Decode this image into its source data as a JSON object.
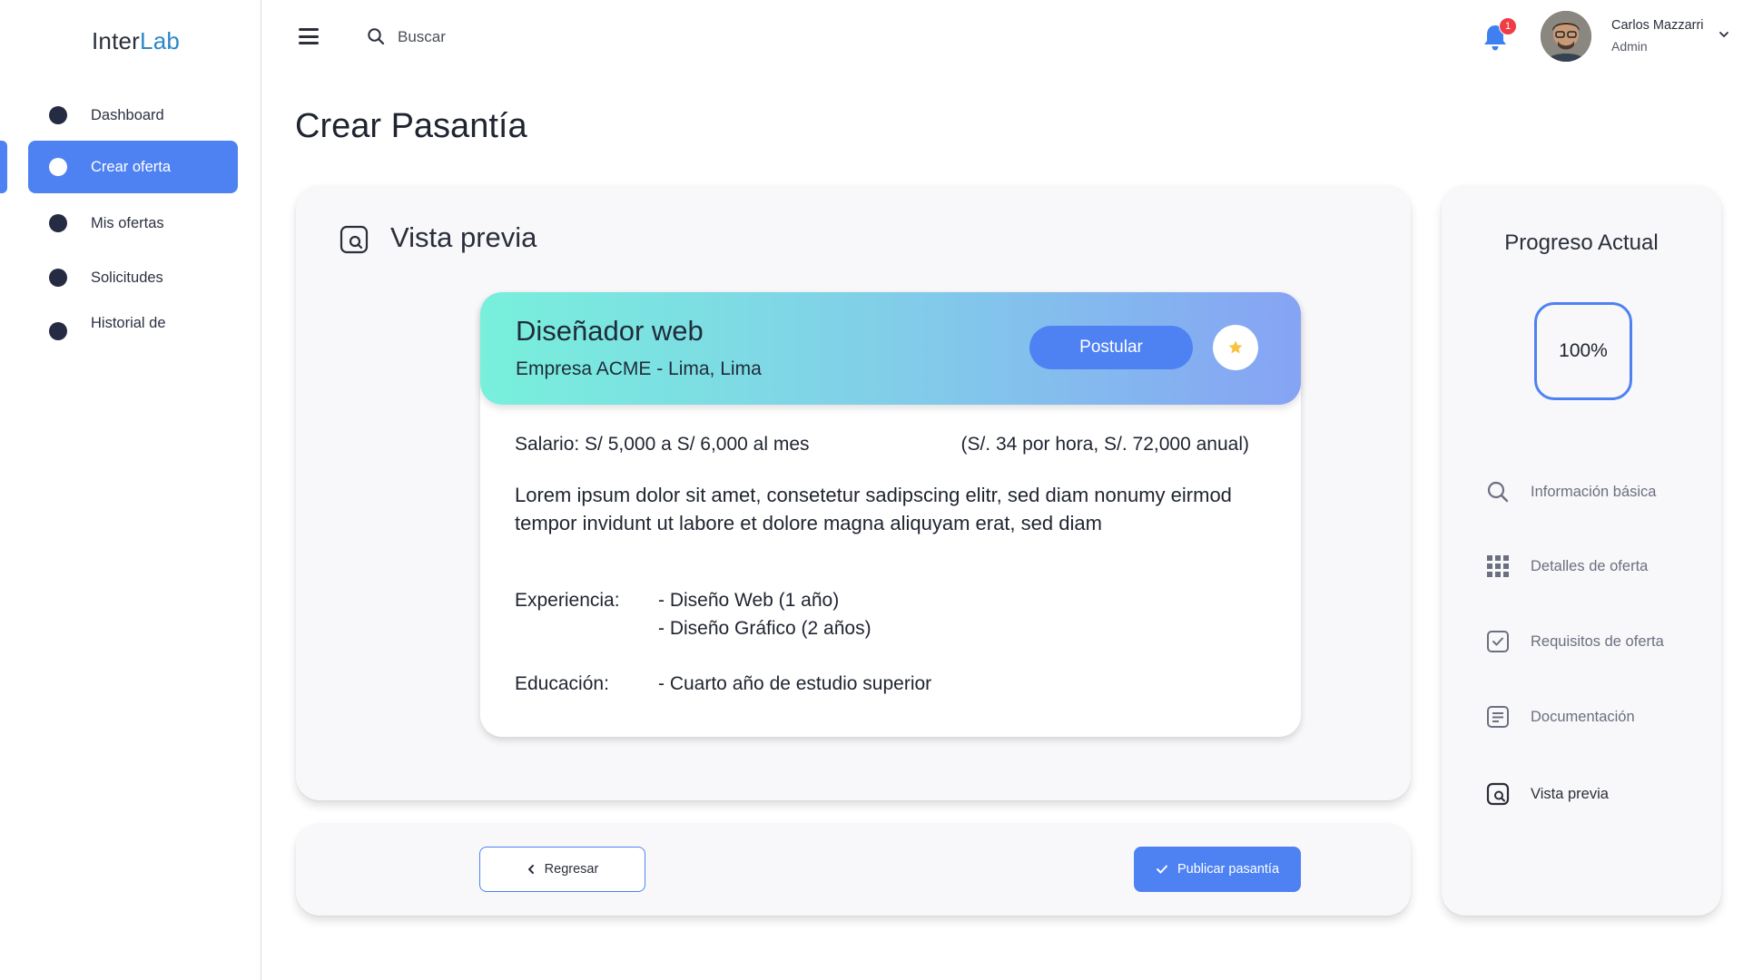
{
  "brand": {
    "part1": "Inter",
    "part2": "Lab"
  },
  "sidebar": {
    "items": [
      {
        "label": "Dashboard"
      },
      {
        "label": "Crear oferta"
      },
      {
        "label": "Mis ofertas"
      },
      {
        "label": "Solicitudes"
      },
      {
        "label": "Historial de"
      }
    ],
    "active_index": 1
  },
  "header": {
    "search_placeholder": "Buscar",
    "notifications_count": "1",
    "user_name": "Carlos Mazzarri",
    "user_role": "Admin"
  },
  "page": {
    "title": "Crear Pasantía"
  },
  "preview": {
    "heading": "Vista previa",
    "job_title": "Diseñador web",
    "company": "Empresa ACME - Lima, Lima",
    "apply_label": "Postular",
    "salary": "Salario: S/ 5,000 a S/ 6,000 al mes",
    "salary_extra": "(S/. 34 por hora, S/. 72,000 anual)",
    "description": "Lorem ipsum dolor sit amet, consetetur sadipscing elitr, sed diam nonumy eirmod tempor invidunt ut labore et dolore magna aliquyam erat, sed diam",
    "experience_label": "Experiencia:",
    "experience_items": [
      "- Diseño Web (1 año)",
      "- Diseño Gráfico (2 años)"
    ],
    "education_label": "Educación:",
    "education_value": "- Cuarto año de estudio superior"
  },
  "actions": {
    "back_label": "Regresar",
    "publish_label": "Publicar pasantía"
  },
  "progress": {
    "title": "Progreso Actual",
    "value_label": "100%",
    "value": 1.0,
    "steps": [
      {
        "label": "Información básica",
        "icon": "search-icon"
      },
      {
        "label": "Detalles de oferta",
        "icon": "grid-icon"
      },
      {
        "label": "Requisitos de oferta",
        "icon": "checkbox-icon"
      },
      {
        "label": "Documentación",
        "icon": "document-icon"
      },
      {
        "label": "Vista previa",
        "icon": "preview-icon"
      }
    ],
    "current_step": 4
  },
  "colors": {
    "accent": "#4e82f3",
    "sidebar_dot": "#262b44",
    "badge": "#ee3d45",
    "star": "#f6c343"
  }
}
